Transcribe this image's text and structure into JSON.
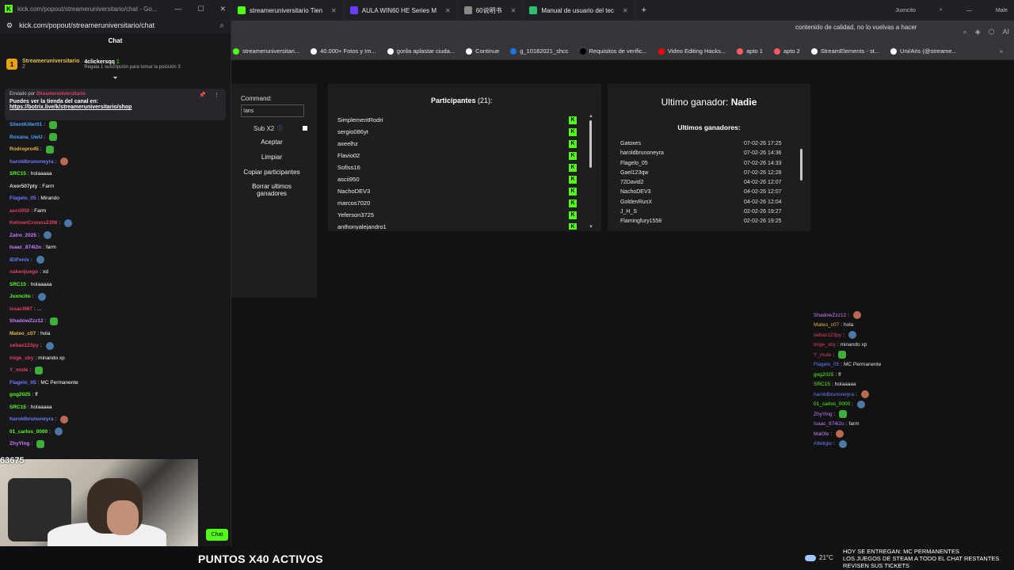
{
  "popout": {
    "window_title": "kick.com/popout/streameruniversitario/chat - Go...",
    "url": "kick.com/popout/streameruniversitario/chat",
    "chat_header": "Chat",
    "sub_banner": {
      "badge": "1",
      "channel": "Streameruniversitario",
      "count": "2",
      "user": "4clickersqq",
      "user_count": "1",
      "note": "Regala 1 suscripción para tomar la posición 3"
    },
    "pinned": {
      "sent_by": "Enviado por",
      "sender": "Streameruniversitario",
      "message": "Puedes ver la tienda del canal en:",
      "link": "https://botrix.live/k/streameruniversitario/shop"
    },
    "messages": [
      {
        "user": "SilentKiller01",
        "msg": "",
        "color": "#4aa3ff",
        "emote": "green"
      },
      {
        "user": "Roxana_UwU",
        "msg": "",
        "color": "#4aa3ff",
        "emote": "green"
      },
      {
        "user": "Rodropro45",
        "msg": "",
        "color": "#e8b344",
        "emote": "green"
      },
      {
        "user": "haroldbrunoneyra",
        "msg": "",
        "color": "#6a7cff",
        "emote": "face"
      },
      {
        "user": "SRC15",
        "msg": "holaaaaa",
        "color": "#53fc18",
        "emote": ""
      },
      {
        "user": "Axor507pty",
        "msg": "Farm",
        "color": "#dddddd",
        "emote": ""
      },
      {
        "user": "Flagelo_05",
        "msg": "Mirando",
        "color": "#6a7cff",
        "emote": ""
      },
      {
        "user": "ascii950",
        "msg": "Farm",
        "color": "#e0415f",
        "emote": ""
      },
      {
        "user": "KelivanCronos2398",
        "msg": "",
        "color": "#e0415f",
        "emote": "pepe"
      },
      {
        "user": "Zairo_2025",
        "msg": "",
        "color": "#c77dff",
        "emote": "pepe"
      },
      {
        "user": "Isaac_874i2o",
        "msg": "farm",
        "color": "#c77dff",
        "emote": ""
      },
      {
        "user": "iEIFenix",
        "msg": "",
        "color": "#6a7cff",
        "emote": "pepe"
      },
      {
        "user": "nakenjuego",
        "msg": "xd",
        "color": "#e0415f",
        "emote": ""
      },
      {
        "user": "SRC15",
        "msg": "holaaaaa",
        "color": "#53fc18",
        "emote": ""
      },
      {
        "user": "Juxncito",
        "msg": "",
        "color": "#53fc18",
        "emote": "pepe"
      },
      {
        "user": "issacl987",
        "msg": "...",
        "color": "#e0415f",
        "emote": ""
      },
      {
        "user": "ShadowZzz12",
        "msg": "",
        "color": "#c77dff",
        "emote": "green"
      },
      {
        "user": "Mateo_c07",
        "msg": "hola",
        "color": "#e8b344",
        "emote": ""
      },
      {
        "user": "sebas123py",
        "msg": "",
        "color": "#e0415f",
        "emote": "pepe"
      },
      {
        "user": "tnige_sby",
        "msg": "minando xp",
        "color": "#e0415f",
        "emote": ""
      },
      {
        "user": "Y_mute",
        "msg": "",
        "color": "#e0415f",
        "emote": "green"
      },
      {
        "user": "Flagelo_05",
        "msg": "MC Permanente",
        "color": "#6a7cff",
        "emote": ""
      },
      {
        "user": "gog2025",
        "msg": "ff",
        "color": "#53fc18",
        "emote": ""
      },
      {
        "user": "SRC15",
        "msg": "holaaaaa",
        "color": "#53fc18",
        "emote": ""
      },
      {
        "user": "haroldbrunoneyra",
        "msg": "",
        "color": "#6a7cff",
        "emote": "face"
      },
      {
        "user": "01_carlos_0000",
        "msg": "",
        "color": "#53fc18",
        "emote": "pepe"
      },
      {
        "user": "ZhyYing",
        "msg": "",
        "color": "#c77dff",
        "emote": "green"
      }
    ],
    "cam_counter": "63675",
    "chat_button": "Chat"
  },
  "browser": {
    "tabs": [
      {
        "label": "streameruniversitario Tien",
        "color": "#53fc18"
      },
      {
        "label": "AULA WIN60 HE Series M",
        "color": "#6a3cff"
      },
      {
        "label": "60说明书",
        "color": "#888888"
      },
      {
        "label": "Manual de usuario del tec",
        "color": "#2fbf71"
      }
    ],
    "profile_name": "Juxncito",
    "profile_short": "Male",
    "omnibox": "contenido de calidad, no lo vuelvas a hacer",
    "toolbar_extra": "AI",
    "bookmarks": [
      {
        "label": "streameruniversitari...",
        "color": "#53fc18"
      },
      {
        "label": "40.000+ Fotos y Im...",
        "color": "#ffffff"
      },
      {
        "label": "gorila aplastar ciuda...",
        "color": "#ffffff"
      },
      {
        "label": "Continue",
        "color": "#ffffff"
      },
      {
        "label": "g_10182021_shcc",
        "color": "#1a73e8"
      },
      {
        "label": "Requisitos de verific...",
        "color": "#000000"
      },
      {
        "label": "Video Editing Hacks...",
        "color": "#ff0000"
      },
      {
        "label": "apto 1",
        "color": "#ff5a5f"
      },
      {
        "label": "apto 2",
        "color": "#ff5a5f"
      },
      {
        "label": "StreamElements - st...",
        "color": "#ffffff"
      },
      {
        "label": "Uni/Aris (@streame...",
        "color": "#ffffff"
      }
    ]
  },
  "giveaway": {
    "command_label": "Command:",
    "command_value": "!aris",
    "sub_x2": "Sub X2",
    "buttons": {
      "accept": "Aceptar",
      "clear": "Limpiar",
      "copy": "Copiar participantes",
      "delete_1": "Borrar ultimos",
      "delete_2": "ganadores"
    },
    "participants_label": "Participantes",
    "participants_count": "(21):",
    "participants": [
      "SimplementRodri",
      "sergio086yt",
      "axeelhz",
      "Flavio02",
      "Sofiss16",
      "ascii950",
      "NachoDEV3",
      "marcos7020",
      "Yeferson3725",
      "anthonyalejandro1"
    ],
    "winner_label": "Ultimo ganador:",
    "winner_name": "Nadie",
    "last_winners_label": "Ultimos ganadores:",
    "last_winners": [
      {
        "name": "Gatoxes",
        "date": "07-02-26 17:25"
      },
      {
        "name": "haroldbrunoneyra",
        "date": "07-02-26 14:36"
      },
      {
        "name": "Flagelo_05",
        "date": "07-02-26 14:33"
      },
      {
        "name": "Gael123qw",
        "date": "07-02-26 12:28"
      },
      {
        "name": "72David2",
        "date": "04-02-26 12:07"
      },
      {
        "name": "NachoDEV3",
        "date": "04-02-26 12:07"
      },
      {
        "name": "GoldenRunX",
        "date": "04-02-26 12:04"
      },
      {
        "name": "J_H_S",
        "date": "02-02-26 19:27"
      },
      {
        "name": "Flamingfury1558",
        "date": "02-02-26 19:25"
      }
    ]
  },
  "right_feed": [
    {
      "user": "ShadowZzz12",
      "msg": "",
      "color": "#c77dff",
      "emote": "face"
    },
    {
      "user": "Mateo_c07",
      "msg": "hola",
      "color": "#e8b344",
      "emote": ""
    },
    {
      "user": "sebas123py",
      "msg": "",
      "color": "#e0415f",
      "emote": "pepe"
    },
    {
      "user": "tnige_sby",
      "msg": "minando xp",
      "color": "#e0415f",
      "emote": ""
    },
    {
      "user": "Y_mute",
      "msg": "",
      "color": "#e0415f",
      "emote": "green"
    },
    {
      "user": "Flagelo_05",
      "msg": "MC Permanente",
      "color": "#6a7cff",
      "emote": ""
    },
    {
      "user": "gog2025",
      "msg": "ff",
      "color": "#53fc18",
      "emote": ""
    },
    {
      "user": "SRC15",
      "msg": "holaaaaa",
      "color": "#53fc18",
      "emote": ""
    },
    {
      "user": "haroldbrunoneyra",
      "msg": "",
      "color": "#6a7cff",
      "emote": "face"
    },
    {
      "user": "01_carlos_0000",
      "msg": "",
      "color": "#53fc18",
      "emote": "pepe"
    },
    {
      "user": "ZhyYing",
      "msg": "",
      "color": "#c77dff",
      "emote": "green"
    },
    {
      "user": "Isaac_874i2o",
      "msg": "farm",
      "color": "#c77dff",
      "emote": ""
    },
    {
      "user": "Mal0fe",
      "msg": "",
      "color": "#c77dff",
      "emote": "face"
    },
    {
      "user": "Atletigio",
      "msg": "",
      "color": "#6a7cff",
      "emote": "pepe"
    }
  ],
  "overlay": {
    "ticker": "PUNTOS X40 ACTIVOS",
    "weather": "21°C",
    "notice_1": "HOY SE ENTREGAN: MC PERMANENTES",
    "notice_2": "LOS JUEGOS DE STEAM A TODO EL CHAT RESTANTES",
    "notice_3": "REVISEN SUS TICKETS"
  }
}
